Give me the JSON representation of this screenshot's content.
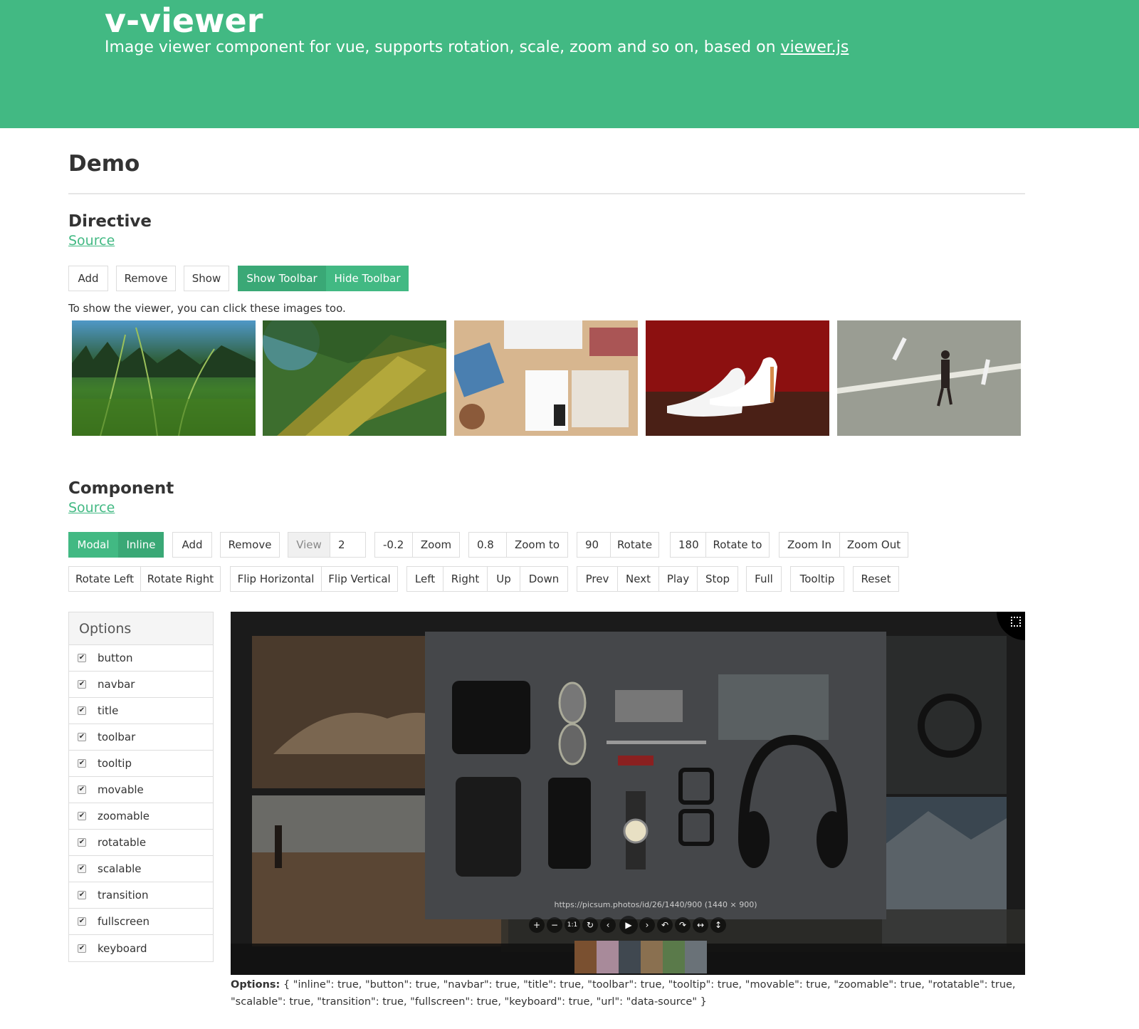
{
  "header": {
    "title": "v-viewer",
    "subtitle": "Image viewer component for vue, supports rotation, scale, zoom and so on, based on",
    "link": "viewer.js",
    "accent_color": "#42b983"
  },
  "demo": {
    "title": "Demo"
  },
  "directive": {
    "title": "Directive",
    "source": "Source",
    "buttons": {
      "add": "Add",
      "remove": "Remove",
      "show": "Show",
      "show_toolbar": "Show Toolbar",
      "hide_toolbar": "Hide Toolbar"
    },
    "hint": "To show the viewer, you can click these images too."
  },
  "component": {
    "title": "Component",
    "source": "Source",
    "row1": {
      "modal": "Modal",
      "inline": "Inline",
      "add": "Add",
      "remove": "Remove",
      "view": "View",
      "view_value": "2",
      "zoom_value": "-0.2",
      "zoom": "Zoom",
      "zoom_to_value": "0.8",
      "zoom_to": "Zoom to",
      "rotate_value": "90",
      "rotate": "Rotate",
      "rotate_to_value": "180",
      "rotate_to": "Rotate to",
      "zoom_in": "Zoom In",
      "zoom_out": "Zoom Out"
    },
    "row2": {
      "rotate_left": "Rotate Left",
      "rotate_right": "Rotate Right",
      "flip_h": "Flip Horizontal",
      "flip_v": "Flip Vertical",
      "left": "Left",
      "right": "Right",
      "up": "Up",
      "down": "Down",
      "prev": "Prev",
      "next": "Next",
      "play": "Play",
      "stop": "Stop",
      "full": "Full",
      "tooltip": "Tooltip",
      "reset": "Reset"
    }
  },
  "options_panel": {
    "title": "Options",
    "items": [
      "button",
      "navbar",
      "title",
      "toolbar",
      "tooltip",
      "movable",
      "zoomable",
      "rotatable",
      "scalable",
      "transition",
      "fullscreen",
      "keyboard"
    ]
  },
  "viewer": {
    "caption": "https://picsum.photos/id/26/1440/900 (1440 × 900)",
    "toolbar_icons": [
      "zoom-in-icon",
      "zoom-out-icon",
      "one-to-one-icon",
      "reset-icon",
      "prev-icon",
      "play-icon",
      "next-icon",
      "rotate-left-icon",
      "rotate-right-icon",
      "flip-horizontal-icon",
      "flip-vertical-icon"
    ],
    "toolbar_glyphs": [
      "+",
      "−",
      "1:1",
      "↻",
      "‹",
      "▶",
      "›",
      "↶",
      "↷",
      "↔",
      "↕"
    ]
  },
  "options_output": {
    "label": "Options:",
    "value": "{ \"inline\": true, \"button\": true, \"navbar\": true, \"title\": true, \"toolbar\": true, \"tooltip\": true, \"movable\": true, \"zoomable\": true, \"rotatable\": true, \"scalable\": true, \"transition\": true, \"fullscreen\": true, \"keyboard\": true, \"url\": \"data-source\" }"
  }
}
